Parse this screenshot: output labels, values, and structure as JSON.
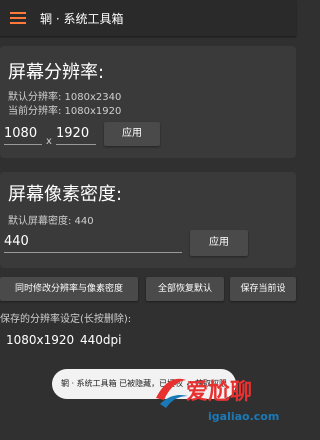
{
  "appbar": {
    "title": "辋 · 系统工具箱",
    "menu_icon": "hamburger-menu-icon"
  },
  "resolution": {
    "title": "屏幕分辨率:",
    "default_line": "默认分辨率: 1080x2340",
    "current_line": "当前分辨率: 1080x1920",
    "width_value": "1080",
    "separator": "x",
    "height_value": "1920",
    "apply_label": "应用"
  },
  "density": {
    "title": "屏幕像素密度:",
    "default_line": "默认屏幕密度: 440",
    "value": "440",
    "apply_label": "应用"
  },
  "actions": {
    "both_label": "同时修改分辨率与像素密度",
    "restore_label": "全部恢复默认",
    "save_label": "保存当前设"
  },
  "saved": {
    "header": "保存的分辨率设定(长按删除):",
    "resolution": "1080x1920",
    "dpi": "440dpi"
  },
  "toast": {
    "text": "辋 · 系统工具箱 已被隐藏，已授权 ✓ 获取权限"
  },
  "watermark": {
    "text": "爱尬聊",
    "url": "igaliao.com",
    "logo": "swoosh-logo"
  },
  "colors": {
    "accent": "#ff7a3a",
    "background": "#303030",
    "card": "#3a3a3a",
    "button": "#4a4a4a"
  }
}
